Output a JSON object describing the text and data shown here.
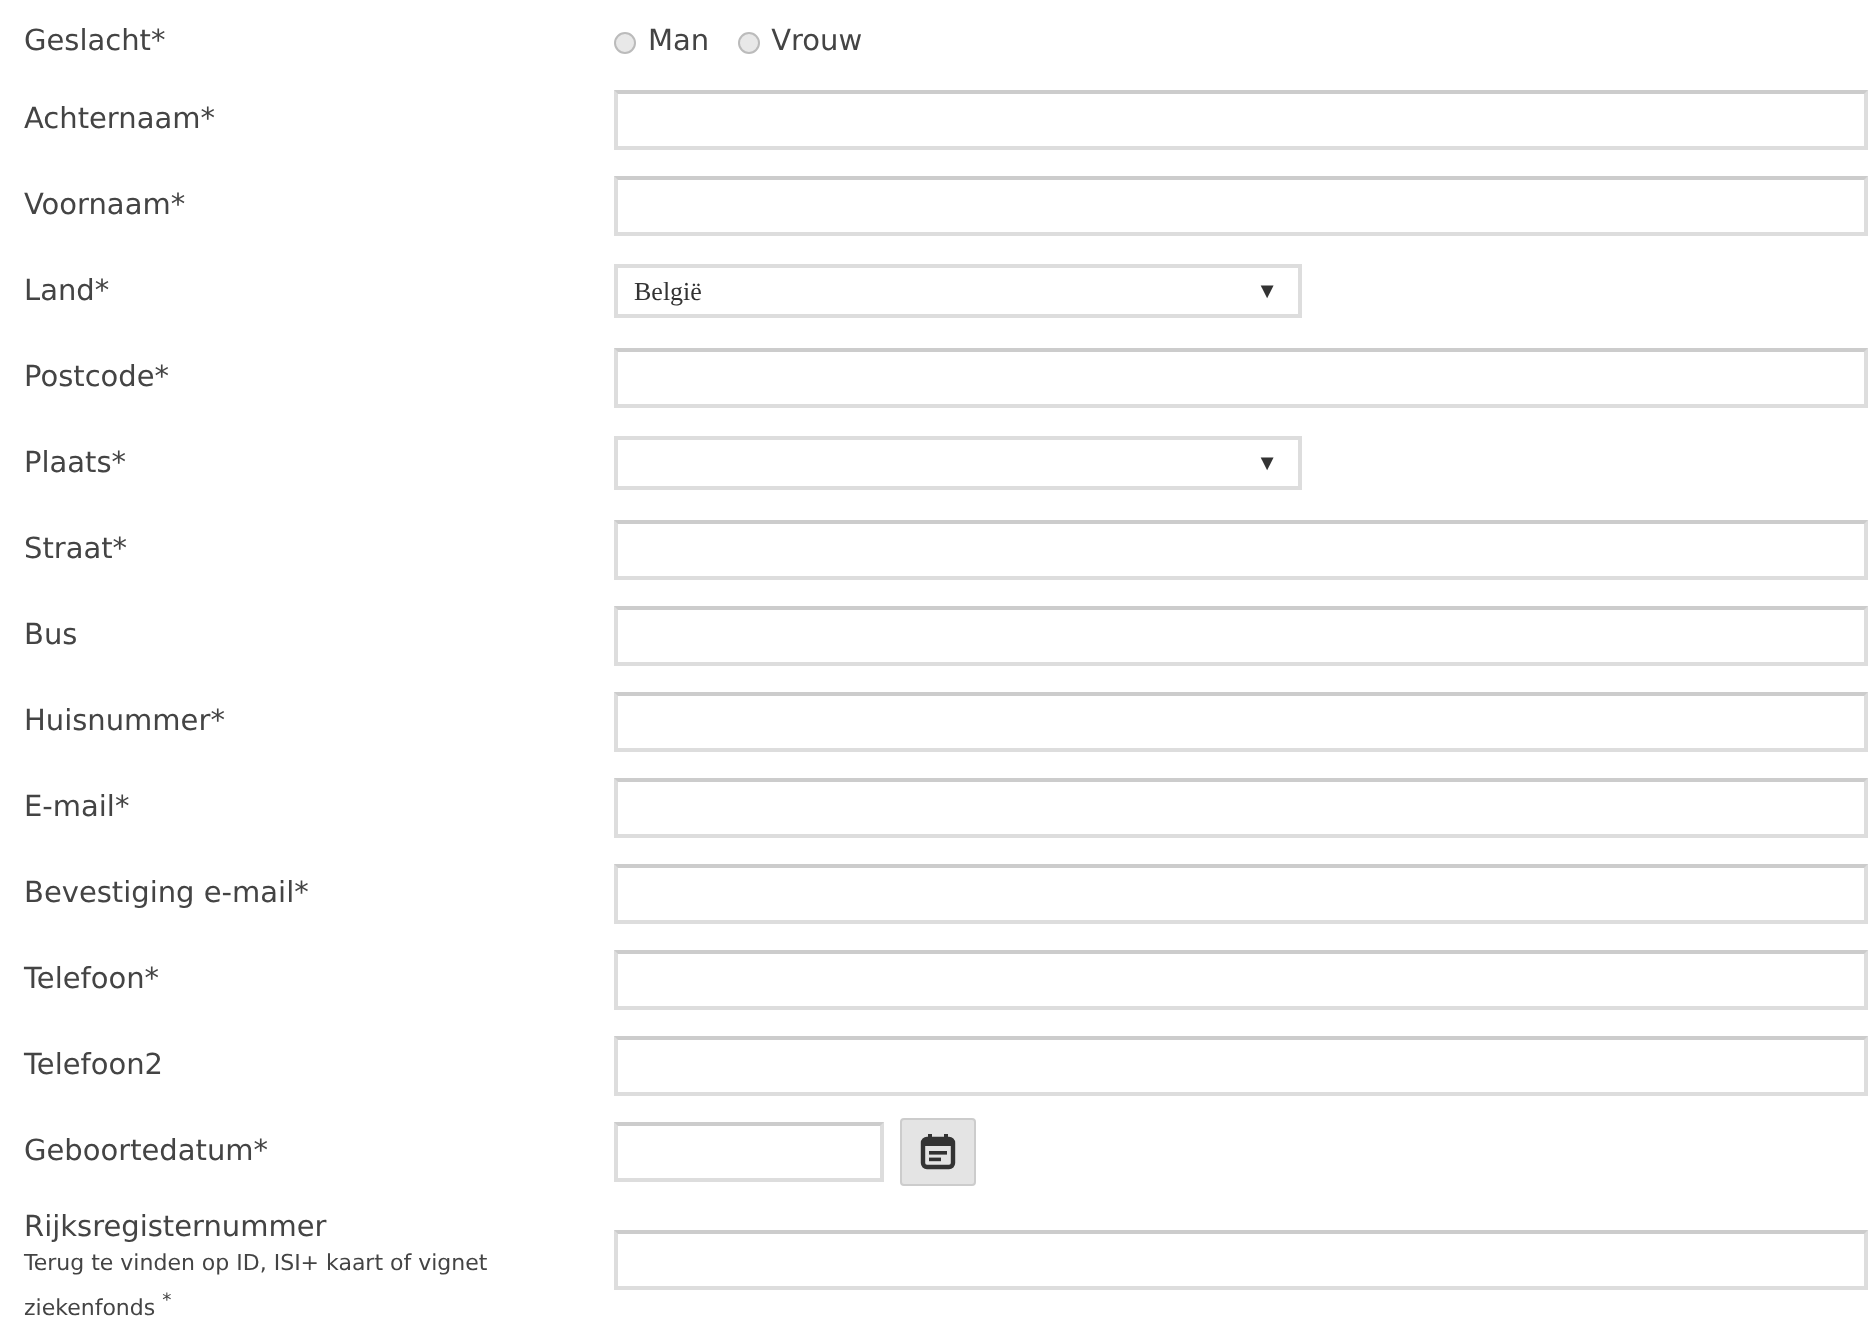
{
  "fields": [
    {
      "kind": "radio",
      "label": "Geslacht*",
      "options": [
        {
          "label": "Man",
          "selected": false
        },
        {
          "label": "Vrouw",
          "selected": false
        }
      ]
    },
    {
      "kind": "text",
      "label": "Achternaam*"
    },
    {
      "kind": "text",
      "label": "Voornaam*"
    },
    {
      "kind": "select",
      "label": "Land*",
      "value": "België",
      "arrow": "▼"
    },
    {
      "kind": "text",
      "label": "Postcode*"
    },
    {
      "kind": "select",
      "label": "Plaats*",
      "arrow": "▼"
    },
    {
      "kind": "text",
      "label": "Straat*"
    },
    {
      "kind": "text",
      "label": "Bus"
    },
    {
      "kind": "text",
      "label": "Huisnummer*"
    },
    {
      "kind": "text",
      "label": "E-mail*"
    },
    {
      "kind": "text",
      "label": "Bevestiging e-mail*"
    },
    {
      "kind": "text",
      "label": "Telefoon*"
    },
    {
      "kind": "text",
      "label": "Telefoon2"
    },
    {
      "kind": "date",
      "label": "Geboortedatum*"
    },
    {
      "kind": "note",
      "label": "Rijksregisternummer",
      "note": "Terug te vinden op ID, ISI+ kaart of vignet ziekenfonds $^{*}$"
    }
  ]
}
